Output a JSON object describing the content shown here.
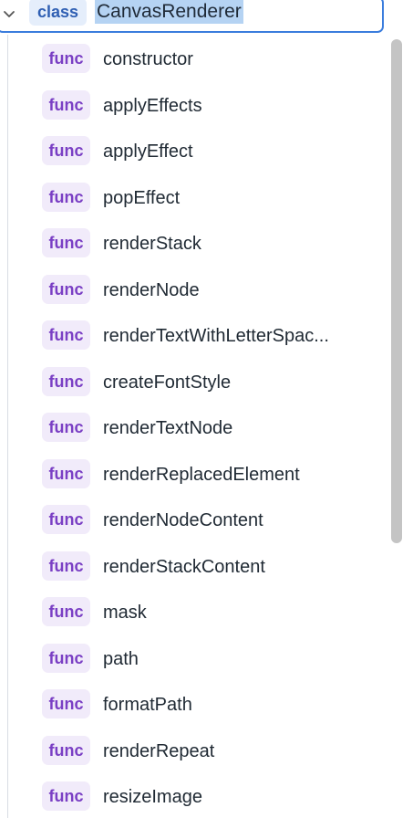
{
  "outline": {
    "class_item": {
      "kind": "class",
      "name": "CanvasRenderer",
      "expand_icon": "chevron-down-icon"
    },
    "members": [
      {
        "kind": "func",
        "name": "constructor"
      },
      {
        "kind": "func",
        "name": "applyEffects"
      },
      {
        "kind": "func",
        "name": "applyEffect"
      },
      {
        "kind": "func",
        "name": "popEffect"
      },
      {
        "kind": "func",
        "name": "renderStack"
      },
      {
        "kind": "func",
        "name": "renderNode"
      },
      {
        "kind": "func",
        "name": "renderTextWithLetterSpac..."
      },
      {
        "kind": "func",
        "name": "createFontStyle"
      },
      {
        "kind": "func",
        "name": "renderTextNode"
      },
      {
        "kind": "func",
        "name": "renderReplacedElement"
      },
      {
        "kind": "func",
        "name": "renderNodeContent"
      },
      {
        "kind": "func",
        "name": "renderStackContent"
      },
      {
        "kind": "func",
        "name": "mask"
      },
      {
        "kind": "func",
        "name": "path"
      },
      {
        "kind": "func",
        "name": "formatPath"
      },
      {
        "kind": "func",
        "name": "renderRepeat"
      },
      {
        "kind": "func",
        "name": "resizeImage"
      }
    ]
  },
  "colors": {
    "selection_border": "#3b7ddd",
    "class_badge_bg": "#e5eefb",
    "class_badge_text": "#2f5fb3",
    "name_highlight": "#b5d3f3",
    "func_badge_bg": "#f1ebfa",
    "func_badge_text": "#7a3fc4",
    "scrollbar_thumb": "#c4c4c4"
  }
}
